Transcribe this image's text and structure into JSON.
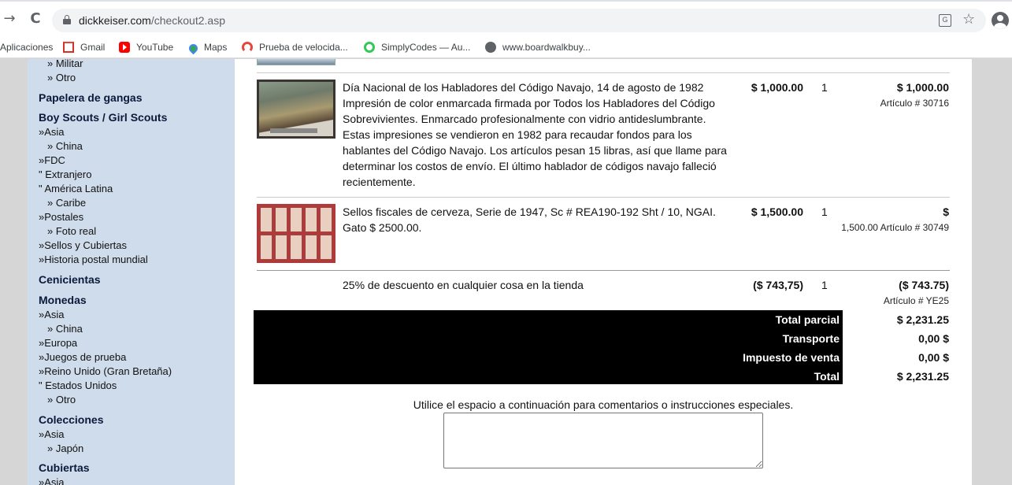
{
  "browser": {
    "url_domain": "dickkeiser.com",
    "url_path": "/checkout2.asp",
    "back_icon": "→",
    "reload_icon": "C"
  },
  "bookmarks": [
    {
      "label": "Aplicaciones",
      "icon": "apps-icon"
    },
    {
      "label": "Gmail",
      "icon": "gmail-icon"
    },
    {
      "label": "YouTube",
      "icon": "youtube-icon"
    },
    {
      "label": "Maps",
      "icon": "maps-icon"
    },
    {
      "label": "Prueba de velocida...",
      "icon": "speedtest-icon"
    },
    {
      "label": "SimplyCodes — Au...",
      "icon": "simplycodes-icon"
    },
    {
      "label": "www.boardwalkbuy...",
      "icon": "globe-icon"
    }
  ],
  "sidebar": {
    "lines": [
      {
        "text": "» Militar",
        "kind": "sub"
      },
      {
        "text": "» Otro",
        "kind": "sub"
      },
      {
        "text": "Papelera de gangas",
        "kind": "head"
      },
      {
        "text": "Boy Scouts / Girl Scouts",
        "kind": "head"
      },
      {
        "text": "»Asia",
        "kind": "item"
      },
      {
        "text": "» China",
        "kind": "sub"
      },
      {
        "text": "»FDC",
        "kind": "item"
      },
      {
        "text": "\" Extranjero",
        "kind": "item"
      },
      {
        "text": "\" América Latina",
        "kind": "item"
      },
      {
        "text": "» Caribe",
        "kind": "sub"
      },
      {
        "text": "»Postales",
        "kind": "item"
      },
      {
        "text": "» Foto real",
        "kind": "sub"
      },
      {
        "text": "»Sellos y Cubiertas",
        "kind": "item"
      },
      {
        "text": "»Historia postal mundial",
        "kind": "item"
      },
      {
        "text": "Cenicientas",
        "kind": "head"
      },
      {
        "text": "Monedas",
        "kind": "head"
      },
      {
        "text": "»Asia",
        "kind": "item"
      },
      {
        "text": "» China",
        "kind": "sub"
      },
      {
        "text": "»Europa",
        "kind": "item"
      },
      {
        "text": "»Juegos de prueba",
        "kind": "item"
      },
      {
        "text": "»Reino Unido (Gran Bretaña)",
        "kind": "item"
      },
      {
        "text": "\" Estados Unidos",
        "kind": "item"
      },
      {
        "text": "» Otro",
        "kind": "sub"
      },
      {
        "text": "Colecciones",
        "kind": "head"
      },
      {
        "text": "»Asia",
        "kind": "item"
      },
      {
        "text": "» Japón",
        "kind": "sub"
      },
      {
        "text": "Cubiertas",
        "kind": "head"
      },
      {
        "text": "»Asia",
        "kind": "item"
      }
    ]
  },
  "cart": {
    "items": [
      {
        "desc_lines": [
          "Día Nacional de los Habladores del Código Navajo, 14 de agosto de 1982",
          "Impresión de color enmarcada firmada por Todos los Habladores del Código",
          "Sobrevivientes. Enmarcado profesionalmente con vidrio antideslumbrante.",
          "Estas impresiones se vendieron en 1982 para recaudar fondos para los",
          "hablantes del Código Navajo. Los artículos pesan 15 libras, así que llame para",
          "determinar los costos de envío. El último hablador de códigos navajo falleció",
          "recientemente."
        ],
        "price": "$ 1,000.00",
        "qty": "1",
        "ext_line1": "$ 1,000.00",
        "ext_line2": "Artículo # 30716"
      },
      {
        "desc_lines": [
          "Sellos fiscales de cerveza, Serie de 1947, Sc # REA190-192 Sht / 10, NGAI.",
          "Gato $ 2500.00."
        ],
        "price": "$ 1,500.00",
        "qty": "1",
        "ext_line1": "$",
        "ext_line2": "1,500.00 Artículo # 30749"
      },
      {
        "desc_lines": [
          "25% de descuento en cualquier cosa en la tienda"
        ],
        "price": "($ 743,75)",
        "qty": "1",
        "ext_line1": "($ 743.75)",
        "ext_line2": "Artículo # YE25"
      }
    ],
    "totals": [
      {
        "label": "Total parcial",
        "value": "$ 2,231.25"
      },
      {
        "label": "Transporte",
        "value": "0,00 $"
      },
      {
        "label": "Impuesto de venta",
        "value": "0,00 $"
      },
      {
        "label": "Total",
        "value": "$ 2,231.25"
      }
    ],
    "comment_label": "Utilice el espacio a continuación para comentarios o instrucciones especiales.",
    "comment_value": ""
  }
}
